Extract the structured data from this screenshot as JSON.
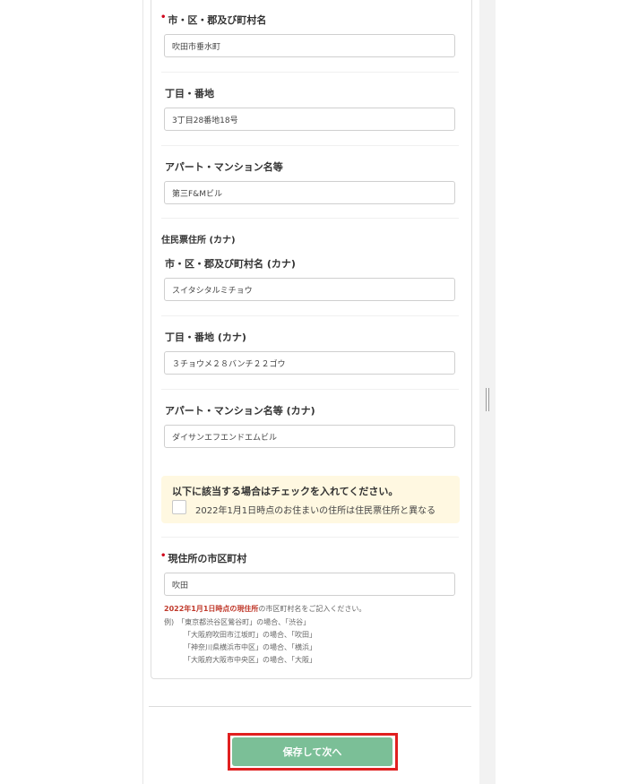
{
  "form": {
    "city": {
      "label": "市・区・郡及び町村名",
      "value": "吹田市垂水町"
    },
    "block": {
      "label": "丁目・番地",
      "value": "3丁目28番地18号"
    },
    "building": {
      "label": "アパート・マンション名等",
      "value": "第三F&Mビル"
    },
    "kana_group_label": "住民票住所 (カナ)",
    "city_kana": {
      "label": "市・区・郡及び町村名 (カナ)",
      "value": "スイタシタルミチョウ"
    },
    "block_kana": {
      "label": "丁目・番地 (カナ)",
      "value": "３チョウメ２８バンチ２２ゴウ"
    },
    "building_kana": {
      "label": "アパート・マンション名等 (カナ)",
      "value": "ダイサンエフエンドエムビル"
    },
    "notice": {
      "title": "以下に該当する場合はチェックを入れてください。",
      "checkbox_label": "2022年1月1日時点のお住まいの住所は住民票住所と異なる"
    },
    "current_city": {
      "label": "現住所の市区町村",
      "value": "吹田",
      "help_highlight": "2022年1月1日時点の現住所",
      "help_rest": "の市区町村名をご記入ください。",
      "examples": [
        "例)　「東京都渋谷区鶯谷町」の場合、「渋谷」",
        "「大阪府吹田市江坂町」の場合、「吹田」",
        "「神奈川県横浜市中区」の場合、「横浜」",
        "「大阪府大阪市中央区」の場合、「大阪」"
      ]
    }
  },
  "footer": {
    "save_label": "保存して次へ"
  },
  "colors": {
    "accent_button": "#7bbf97",
    "required": "#d0021b",
    "highlight_frame": "#e02020",
    "notice_bg": "#fff8e1"
  }
}
